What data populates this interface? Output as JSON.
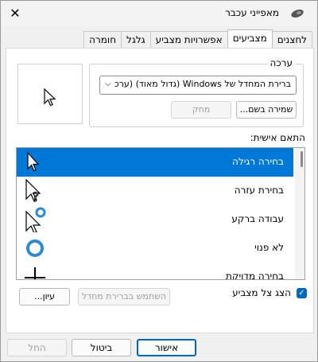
{
  "window": {
    "title": "מאפייני עכבר",
    "close_glyph": "✕"
  },
  "tabs": [
    "לחצנים",
    "מצביעים",
    "אפשרויות מצביע",
    "גלגל",
    "חומרה"
  ],
  "scheme": {
    "group_label": "ערכה",
    "selected": "ברירת המחדל של Windows (גדול מאוד) (ערכ",
    "save_as": "שמירה בשם...",
    "delete": "מחק"
  },
  "customize": {
    "label": "התאם אישית:",
    "items": [
      {
        "label": "בחירה רגילה",
        "cursor": "arrow-cursor-icon"
      },
      {
        "label": "בחירת עזרה",
        "cursor": "help-cursor-icon"
      },
      {
        "label": "עבודה ברקע",
        "cursor": "working-cursor-icon"
      },
      {
        "label": "לא פנוי",
        "cursor": "busy-cursor-icon"
      },
      {
        "label": "בחירה מדויקת",
        "cursor": "crosshair-cursor-icon"
      }
    ]
  },
  "shadow": {
    "label": "הצג צל מצביע",
    "checked": true
  },
  "use_default": "השתמש בברירת מחדל",
  "browse": "עיון...",
  "footer": {
    "ok": "אישור",
    "cancel": "ביטול",
    "apply": "החל"
  },
  "colors": {
    "accent": "#0078d7",
    "checkbox": "#0067c0"
  }
}
